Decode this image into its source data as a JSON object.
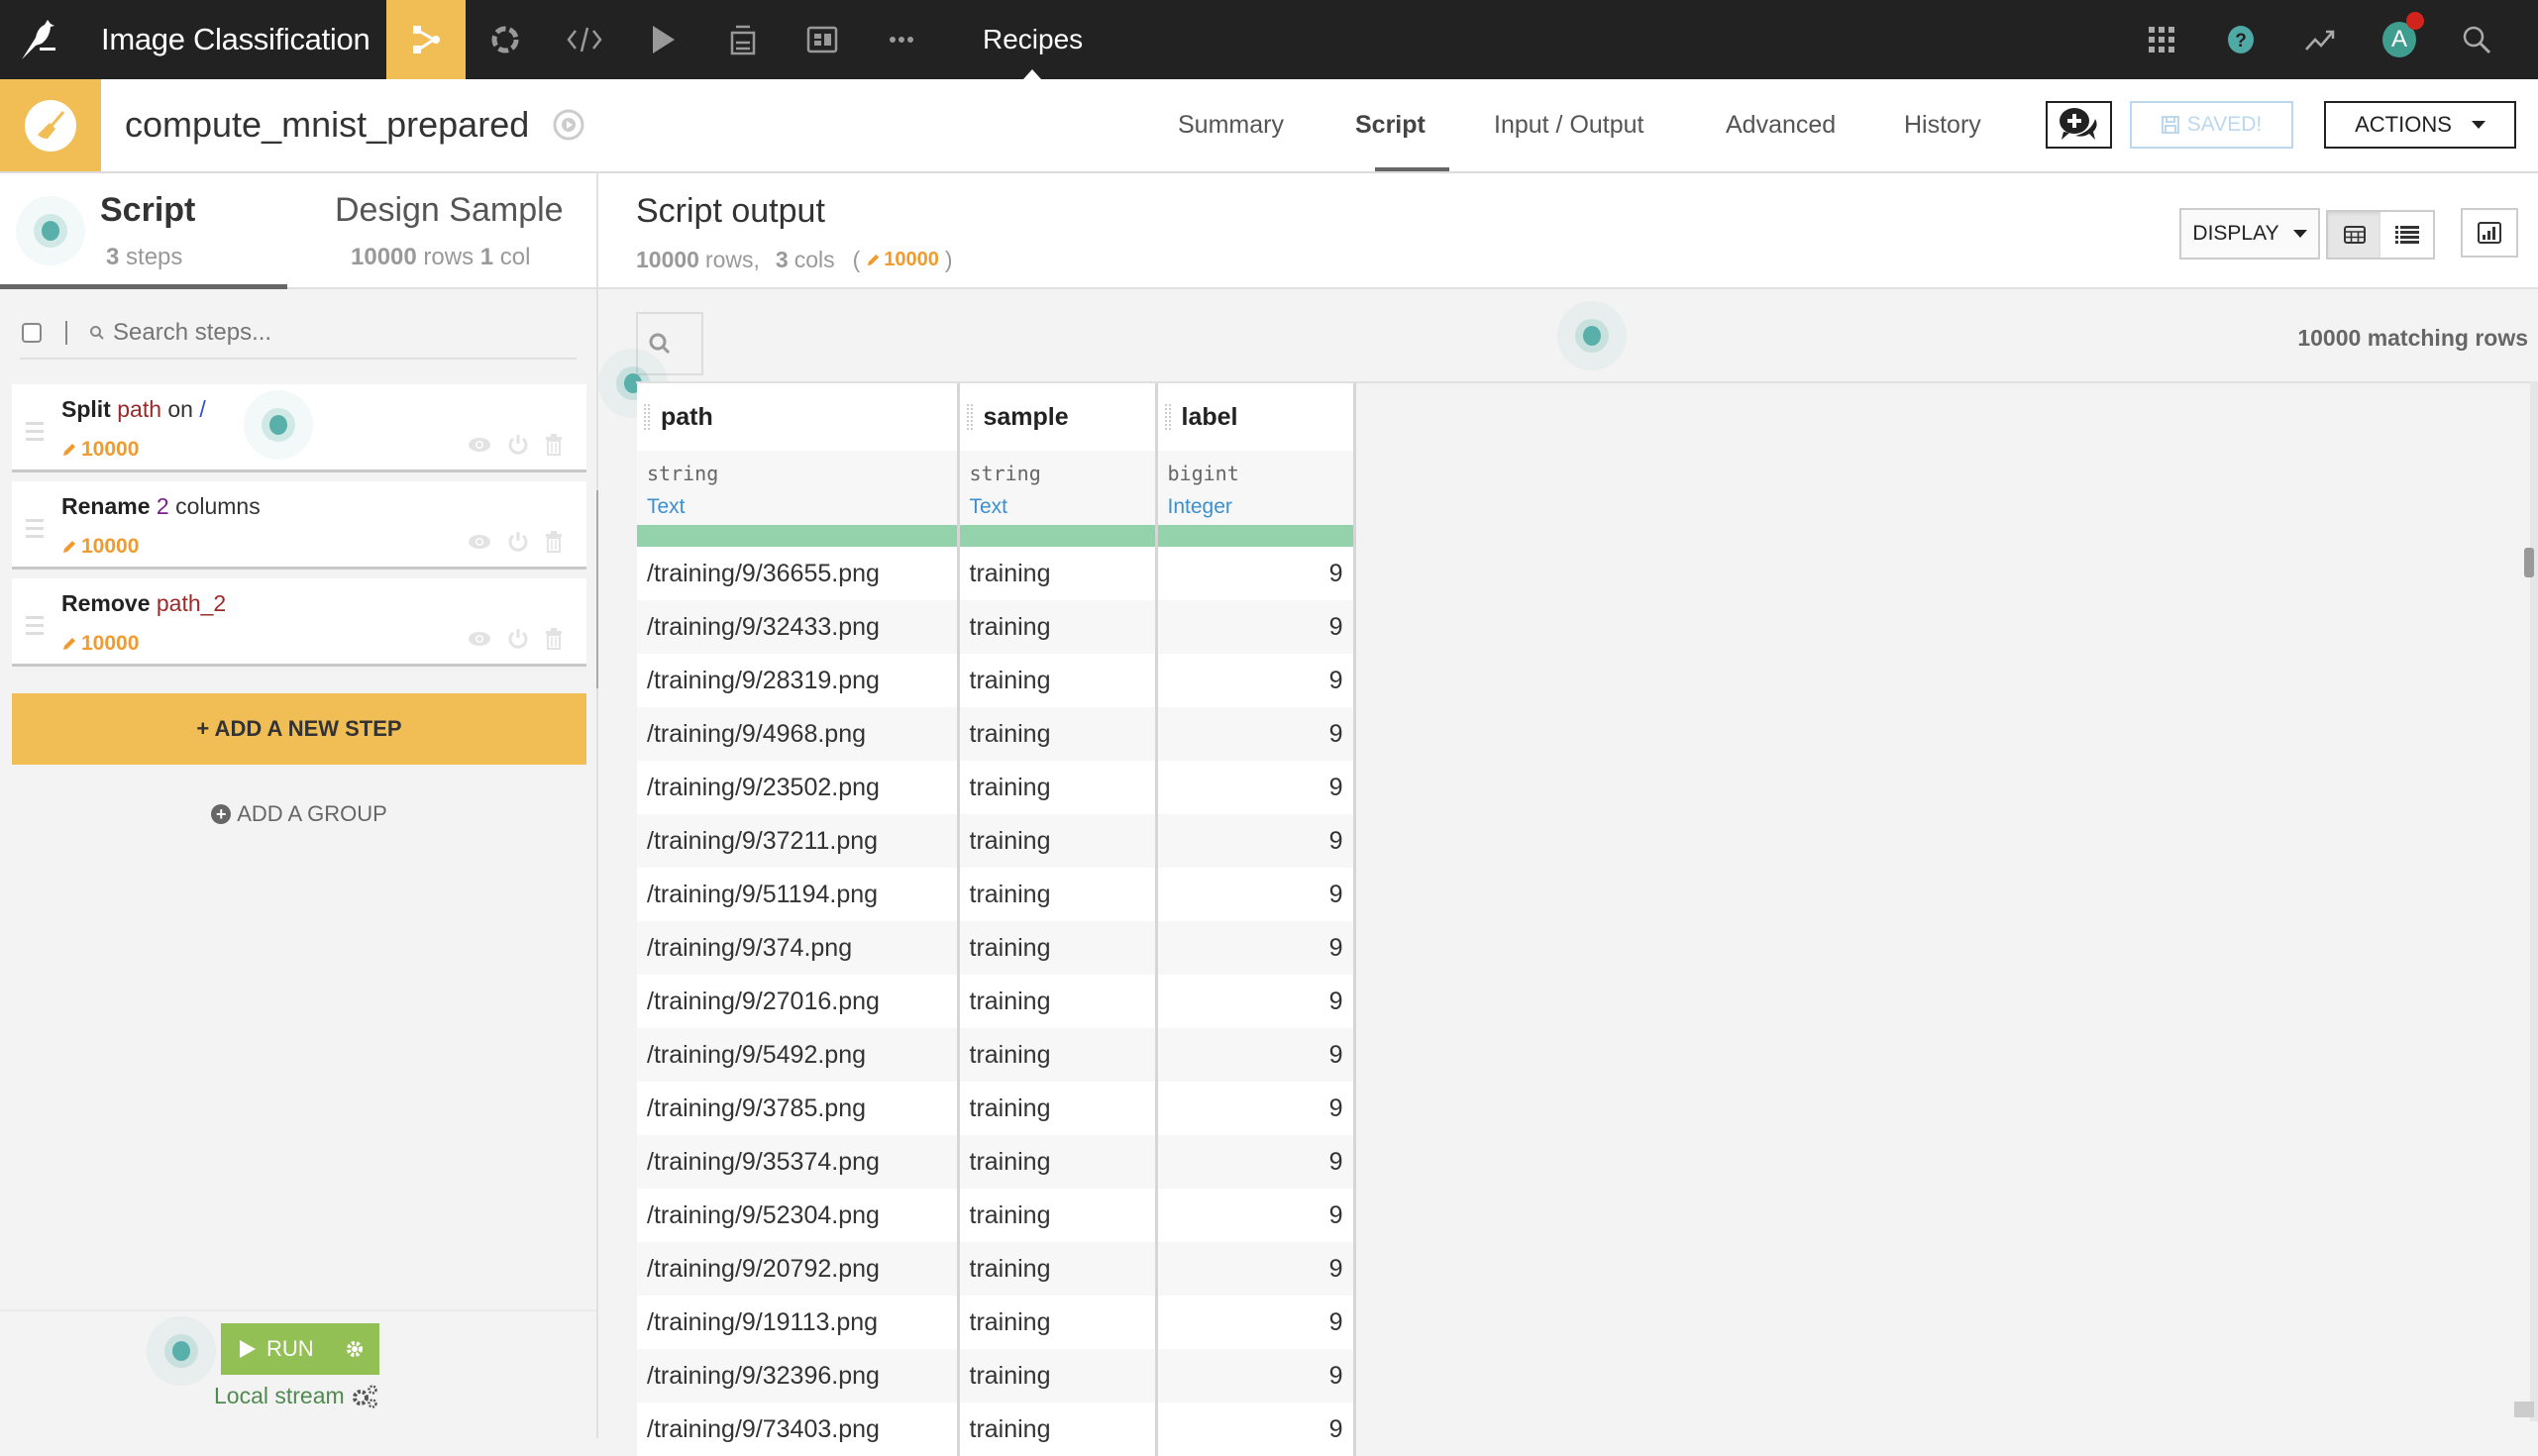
{
  "topnav": {
    "project_title": "Image Classification",
    "section_label": "Recipes",
    "icons": [
      "flow-icon",
      "jobs-icon",
      "code-icon",
      "run-icon",
      "datasets-icon",
      "dashboard-icon",
      "more-icon"
    ],
    "right_icons": [
      "apps-grid-icon",
      "help-icon",
      "activity-icon",
      "avatar",
      "search-icon"
    ],
    "avatar_initial": "A",
    "accent_color": "#f0be55"
  },
  "recipe": {
    "name": "compute_mnist_prepared",
    "tabs": [
      {
        "label": "Summary",
        "active": false
      },
      {
        "label": "Script",
        "active": true
      },
      {
        "label": "Input / Output",
        "active": false
      },
      {
        "label": "Advanced",
        "active": false
      },
      {
        "label": "History",
        "active": false
      }
    ],
    "saved_label": "SAVED!",
    "actions_label": "ACTIONS"
  },
  "left_panel": {
    "script_tab": {
      "title": "Script",
      "count": "3",
      "count_suffix": "steps"
    },
    "sample_tab": {
      "title": "Design Sample",
      "rows": "10000",
      "rows_label": "rows",
      "cols": "1",
      "cols_label": "col"
    },
    "search_placeholder": "Search steps...",
    "steps": [
      {
        "verb": "Split",
        "parts": [
          {
            "text": "path",
            "style": "red"
          },
          {
            "text": "on",
            "style": "plain"
          },
          {
            "text": "/",
            "style": "blue"
          }
        ],
        "count": "10000"
      },
      {
        "verb": "Rename",
        "parts": [
          {
            "text": "2",
            "style": "purple"
          },
          {
            "text": "columns",
            "style": "plain"
          }
        ],
        "count": "10000"
      },
      {
        "verb": "Remove",
        "parts": [
          {
            "text": "path_2",
            "style": "red"
          }
        ],
        "count": "10000"
      }
    ],
    "add_step_label": "+ ADD A NEW STEP",
    "add_group_label": "ADD A GROUP",
    "run_label": "RUN",
    "engine_label": "Local stream"
  },
  "output": {
    "title": "Script output",
    "rows": "10000",
    "rows_label": "rows,",
    "cols": "3",
    "cols_label": "cols",
    "sample_count": "10000",
    "display_label": "DISPLAY",
    "matching_rows": "10000 matching rows",
    "columns": [
      {
        "name": "path",
        "storage": "string",
        "meaning": "Text"
      },
      {
        "name": "sample",
        "storage": "string",
        "meaning": "Text"
      },
      {
        "name": "label",
        "storage": "bigint",
        "meaning": "Integer"
      }
    ],
    "rows_data": [
      [
        "/training/9/36655.png",
        "training",
        "9"
      ],
      [
        "/training/9/32433.png",
        "training",
        "9"
      ],
      [
        "/training/9/28319.png",
        "training",
        "9"
      ],
      [
        "/training/9/4968.png",
        "training",
        "9"
      ],
      [
        "/training/9/23502.png",
        "training",
        "9"
      ],
      [
        "/training/9/37211.png",
        "training",
        "9"
      ],
      [
        "/training/9/51194.png",
        "training",
        "9"
      ],
      [
        "/training/9/374.png",
        "training",
        "9"
      ],
      [
        "/training/9/27016.png",
        "training",
        "9"
      ],
      [
        "/training/9/5492.png",
        "training",
        "9"
      ],
      [
        "/training/9/3785.png",
        "training",
        "9"
      ],
      [
        "/training/9/35374.png",
        "training",
        "9"
      ],
      [
        "/training/9/52304.png",
        "training",
        "9"
      ],
      [
        "/training/9/20792.png",
        "training",
        "9"
      ],
      [
        "/training/9/19113.png",
        "training",
        "9"
      ],
      [
        "/training/9/32396.png",
        "training",
        "9"
      ],
      [
        "/training/9/73403.png",
        "training",
        "9"
      ]
    ],
    "quality_color": "#94d2ac"
  }
}
